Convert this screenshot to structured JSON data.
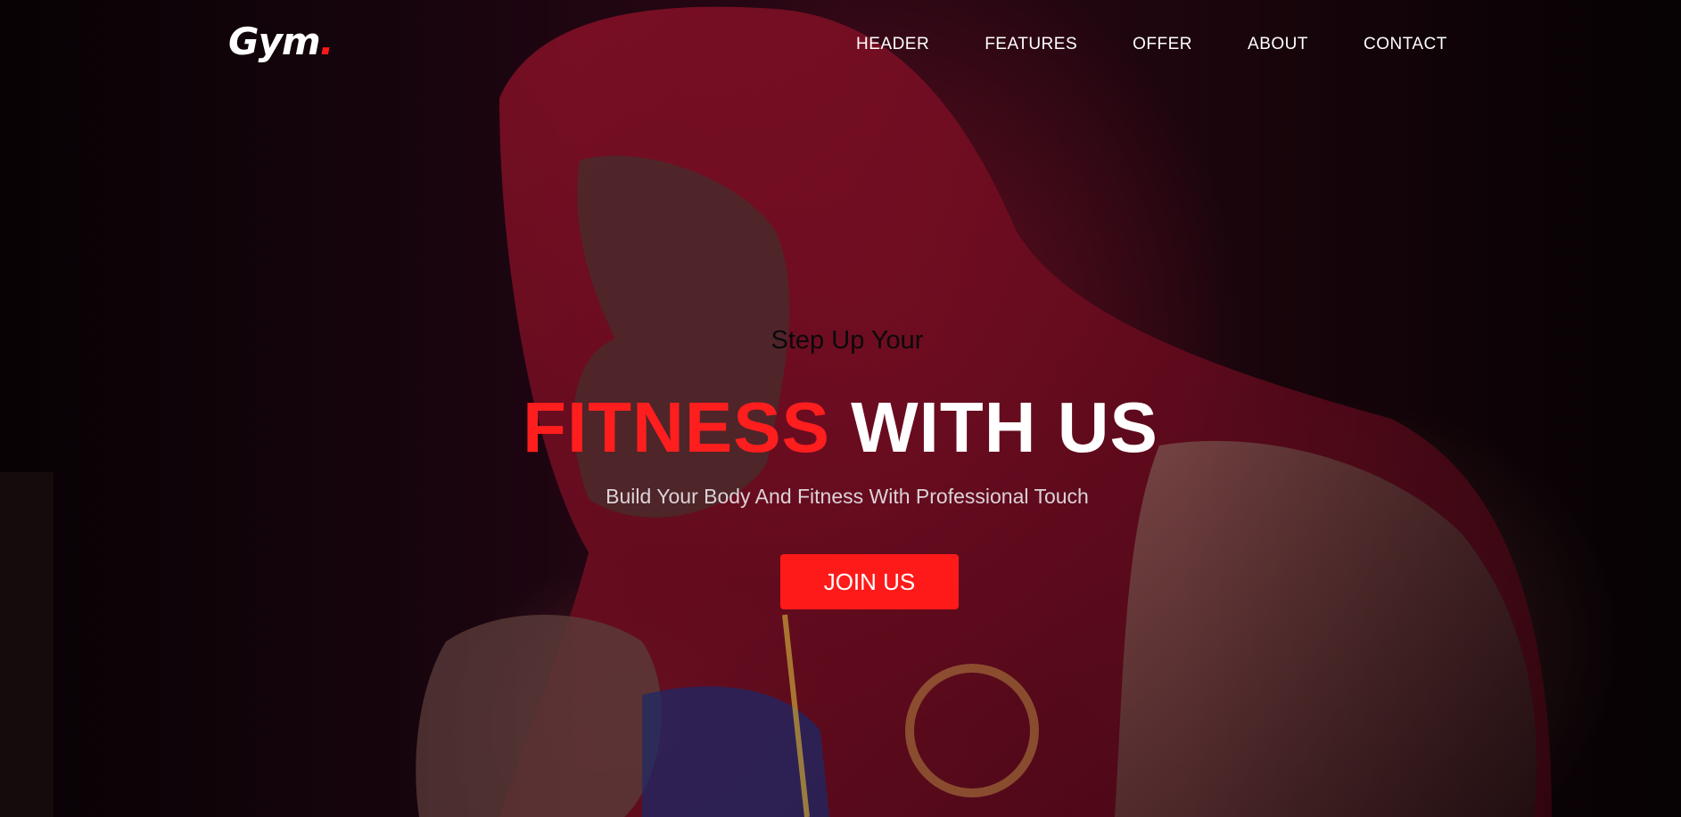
{
  "brand": {
    "logo_text": "Gym",
    "logo_dot": ".",
    "accent_color": "#ff1a1a"
  },
  "nav": {
    "items": [
      {
        "label": "HEADER"
      },
      {
        "label": "FEATURES"
      },
      {
        "label": "OFFER"
      },
      {
        "label": "ABOUT"
      },
      {
        "label": "CONTACT"
      }
    ]
  },
  "hero": {
    "subtitle": "Step Up Your",
    "headline_accent": "FITNESS",
    "headline_rest": "WITH US",
    "tagline": "Build Your Body And Fitness With Professional Touch",
    "cta_label": "JOIN US",
    "background_image": "hooded-boxer-photo"
  }
}
